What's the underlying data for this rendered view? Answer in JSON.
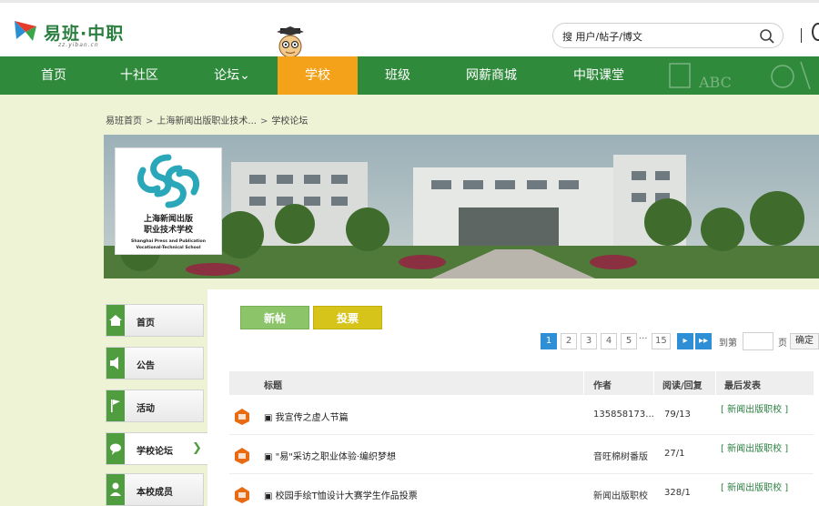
{
  "header": {
    "logo_text": "易班·中职",
    "logo_sub": "zz.yiban.cn",
    "search_placeholder": "搜 用户/帖子/博文"
  },
  "nav": {
    "items": [
      "首页",
      "十社区",
      "论坛⌄",
      "学校",
      "班级",
      "网薪商城",
      "中职课堂"
    ]
  },
  "breadcrumb": {
    "items": [
      "易班首页",
      "上海新闻出版职业技术...",
      "学校论坛"
    ]
  },
  "school": {
    "logo_name_line1": "上海新闻出版",
    "logo_name_line2": "职业技术学校",
    "logo_en_line1": "Shanghai Press and Publication",
    "logo_en_line2": "Vocational-Technical School"
  },
  "sidebar": {
    "items": [
      {
        "label": "首页",
        "icon": "home-icon"
      },
      {
        "label": "公告",
        "icon": "speaker-icon"
      },
      {
        "label": "活动",
        "icon": "flag-icon"
      },
      {
        "label": "学校论坛",
        "icon": "chat-icon"
      },
      {
        "label": "本校成员",
        "icon": "user-icon"
      }
    ],
    "active_chevron": "❯"
  },
  "actions": {
    "new_post": "新帖",
    "vote": "投票"
  },
  "pager": {
    "pages": [
      "1",
      "2",
      "3",
      "4",
      "5"
    ],
    "dots": "···",
    "last_page": "15",
    "next": "▸",
    "last": "▸▸",
    "goto_label": "到第",
    "page_label": "页",
    "confirm": "确定"
  },
  "table": {
    "headers": [
      "标题",
      "作者",
      "阅读/回复",
      "最后发表"
    ],
    "rows": [
      {
        "title": "▣ 我宣传之虚人节篇",
        "author": "135858173...",
        "stats": "79/13",
        "last": "[ 新闻出版职校 ]"
      },
      {
        "title": "▣ \"易\"采访之职业体验·编织梦想",
        "author": "音旺棉树番版",
        "stats": "27/1",
        "last": "[ 新闻出版职校 ]"
      },
      {
        "title": "▣ 校园手绘T恤设计大赛学生作品投票",
        "author": "新闻出版职校",
        "stats": "328/1",
        "last": "[ 新闻出版职校 ]"
      }
    ]
  },
  "colors": {
    "nav_green": "#2f8a3c",
    "nav_active": "#f5a21b",
    "pager_blue": "#2f8fd6",
    "btn_green": "#8cc46a",
    "btn_yellow": "#d6c41a"
  }
}
